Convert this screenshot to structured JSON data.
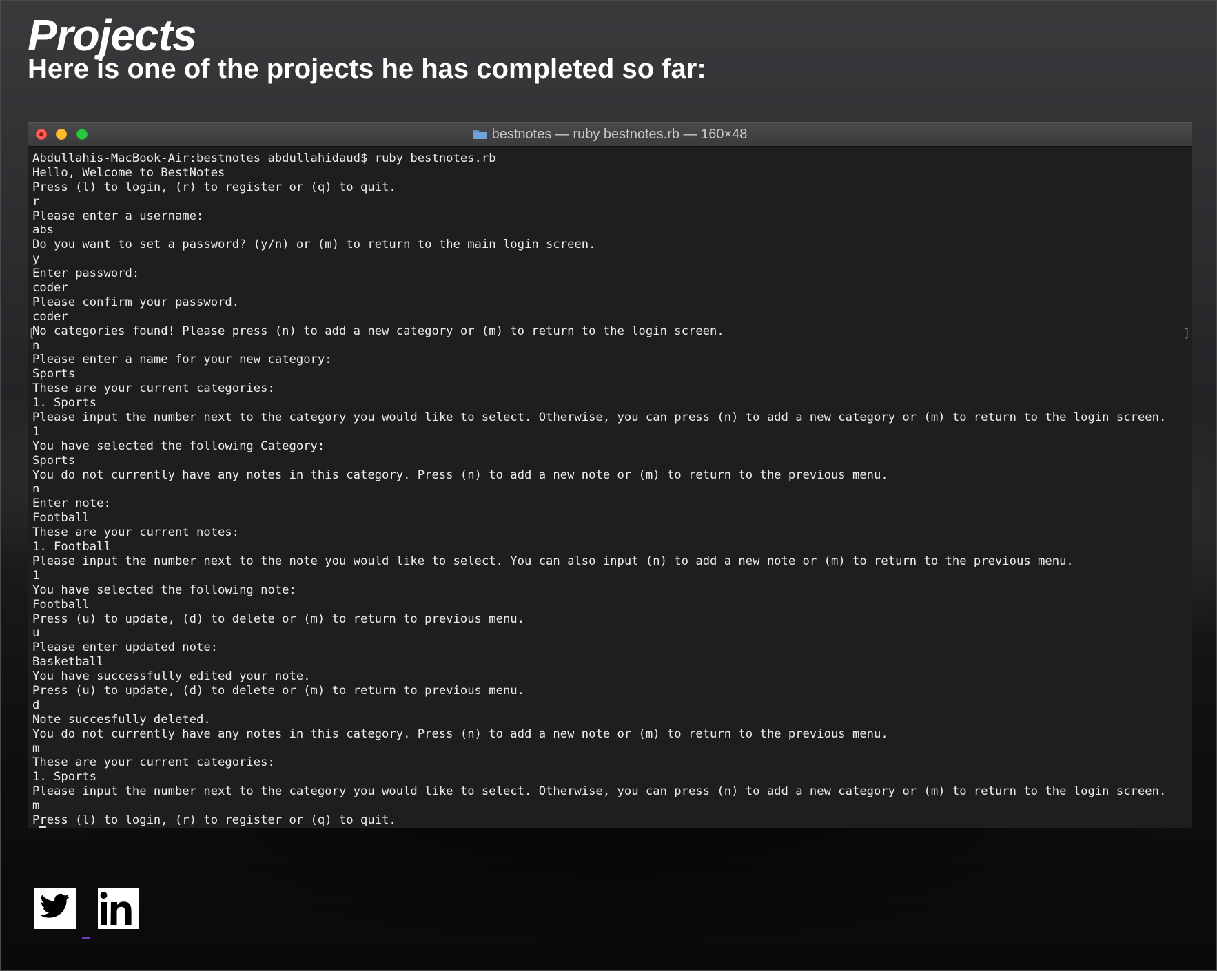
{
  "page": {
    "title": "Projects",
    "subtitle": "Here is one of the projects he has completed so far:"
  },
  "terminal": {
    "window_title": "bestnotes — ruby bestnotes.rb — 160×48",
    "lines": [
      "Abdullahis-MacBook-Air:bestnotes abdullahidaud$ ruby bestnotes.rb",
      "Hello, Welcome to BestNotes",
      "Press (l) to login, (r) to register or (q) to quit.",
      "r",
      "Please enter a username:",
      "abs",
      "Do you want to set a password? (y/n) or (m) to return to the main login screen.",
      "y",
      "Enter password:",
      "coder",
      "Please confirm your password.",
      "coder",
      "No categories found! Please press (n) to add a new category or (m) to return to the login screen.",
      "n",
      "Please enter a name for your new category:",
      "Sports",
      "These are your current categories:",
      "1. Sports",
      "Please input the number next to the category you would like to select. Otherwise, you can press (n) to add a new category or (m) to return to the login screen.",
      "1",
      "You have selected the following Category:",
      "Sports",
      "You do not currently have any notes in this category. Press (n) to add a new note or (m) to return to the previous menu.",
      "n",
      "Enter note:",
      "Football",
      "These are your current notes:",
      "1. Football",
      "Please input the number next to the note you would like to select. You can also input (n) to add a new note or (m) to return to the previous menu.",
      "1",
      "You have selected the following note:",
      "Football",
      "Press (u) to update, (d) to delete or (m) to return to previous menu.",
      "u",
      "Please enter updated note:",
      "Basketball",
      "You have successfully edited your note.",
      "Press (u) to update, (d) to delete or (m) to return to previous menu.",
      "d",
      "Note succesfully deleted.",
      "You do not currently have any notes in this category. Press (n) to add a new note or (m) to return to the previous menu.",
      "m",
      "These are your current categories:",
      "1. Sports",
      "Please input the number next to the category you would like to select. Otherwise, you can press (n) to add a new category or (m) to return to the login screen.",
      "m",
      "Press (l) to login, (r) to register or (q) to quit."
    ]
  },
  "social": {
    "icons": [
      "twitter-icon",
      "linkedin-icon"
    ]
  },
  "colors": {
    "terminal_bg": "#1e1e1e",
    "terminal_text": "#ededed",
    "close": "#fe5f57",
    "minimize": "#febc2e",
    "zoom": "#28c840",
    "folder": "#5f93c9"
  }
}
